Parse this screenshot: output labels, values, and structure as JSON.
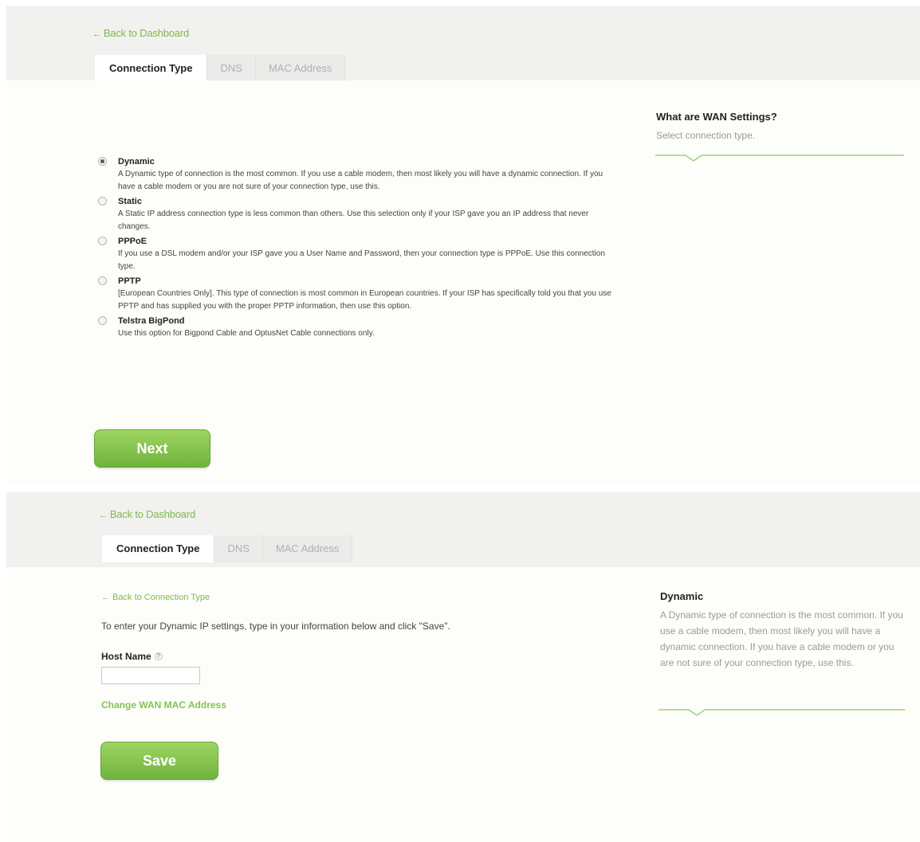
{
  "wizard": {
    "back_to_dashboard": "Back to Dashboard",
    "tabs": [
      "Connection Type",
      "DNS",
      "MAC Address"
    ],
    "options": [
      {
        "title": "Dynamic",
        "description": "A Dynamic type of connection is the most common. If you use a cable modem, then most likely you will have a dynamic connection. If you have a cable modem or you are not sure of your connection type, use this.",
        "selected": true
      },
      {
        "title": "Static",
        "description": "A Static IP address connection type is less common than others. Use this selection only if your ISP gave you an IP address that never changes.",
        "selected": false
      },
      {
        "title": "PPPoE",
        "description": "If you use a DSL modem and/or your ISP gave you a User Name and Password, then your connection type is PPPoE. Use this connection type.",
        "selected": false
      },
      {
        "title": "PPTP",
        "description": "[European Countries Only]. This type of connection is most common in European countries. If your ISP has specifically told you that you use PPTP and has supplied you with the proper PPTP information, then use this option.",
        "selected": false
      },
      {
        "title": "Telstra BigPond",
        "description": "Use this option for Bigpond Cable and OptusNet Cable connections only.",
        "selected": false
      }
    ],
    "next_label": "Next",
    "sidebar": {
      "title": "What are WAN Settings?",
      "text": "Select connection type."
    }
  },
  "dynamic": {
    "back_to_dashboard": "Back to Dashboard",
    "tabs": [
      "Connection Type",
      "DNS",
      "MAC Address"
    ],
    "back_to_connection_type": "Back to Connection Type",
    "instructions": "To enter your Dynamic IP settings, type in your information below and click \"Save\".",
    "host_name_label": "Host Name",
    "host_name_value": "",
    "change_mac_label": "Change WAN MAC Address",
    "save_label": "Save",
    "sidebar": {
      "title": "Dynamic",
      "text": "A Dynamic type of connection is the most common. If you use a cable modem, then most likely you will have a dynamic connection. If you have a cable modem or you are not sure of your connection type, use this."
    }
  },
  "colors": {
    "accent": "#7dba4a",
    "button_top": "#9ed462",
    "button_bottom": "#6fb43c",
    "header_bg": "#f1f1f0"
  },
  "icons": {
    "back_arrow": "arrow-left-icon",
    "help": "help-circle-icon",
    "divider_notch": "chevron-down-notch-icon"
  }
}
